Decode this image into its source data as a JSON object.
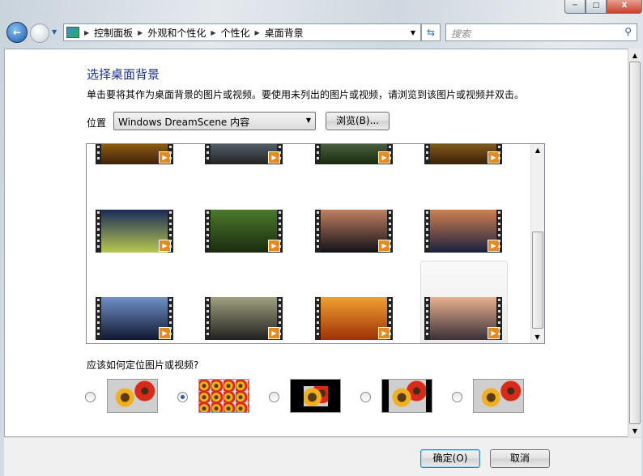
{
  "window": {
    "minimize": "─",
    "maximize": "□",
    "close": "X"
  },
  "address": {
    "crumbs": [
      "控制面板",
      "外观和个性化",
      "个性化",
      "桌面背景"
    ]
  },
  "search": {
    "placeholder": "搜索"
  },
  "page": {
    "title": "选择桌面背景",
    "description": "单击要将其作为桌面背景的图片或视频。要使用未列出的图片或视频，请浏览到该图片或视频并双击。",
    "location_label": "位置",
    "location_value": "Windows DreamScene 内容",
    "browse_button": "浏览(B)...",
    "position_question": "应该如何定位图片或视频?",
    "selected_position_index": 1
  },
  "thumbnails": [
    {
      "colors": [
        "#e0a020",
        "#402008"
      ]
    },
    {
      "colors": [
        "#8aa0b8",
        "#222"
      ]
    },
    {
      "colors": [
        "#7a9a6a",
        "#1a2a10"
      ]
    },
    {
      "colors": [
        "#d09a30",
        "#3a2008"
      ]
    },
    {
      "colors": [
        "#1a2a5a",
        "#b8c850"
      ]
    },
    {
      "colors": [
        "#4a7a2a",
        "#1a2a10"
      ]
    },
    {
      "colors": [
        "#c08060",
        "#101018"
      ]
    },
    {
      "colors": [
        "#d08050",
        "#1a2040"
      ]
    },
    {
      "colors": [
        "#7090c8",
        "#101830"
      ]
    },
    {
      "colors": [
        "#a0a080",
        "#202020"
      ]
    },
    {
      "colors": [
        "#f0a030",
        "#a03008"
      ]
    },
    {
      "colors": [
        "#e8b090",
        "#3a3038"
      ]
    }
  ],
  "footer": {
    "ok": "确定(O)",
    "cancel": "取消"
  }
}
